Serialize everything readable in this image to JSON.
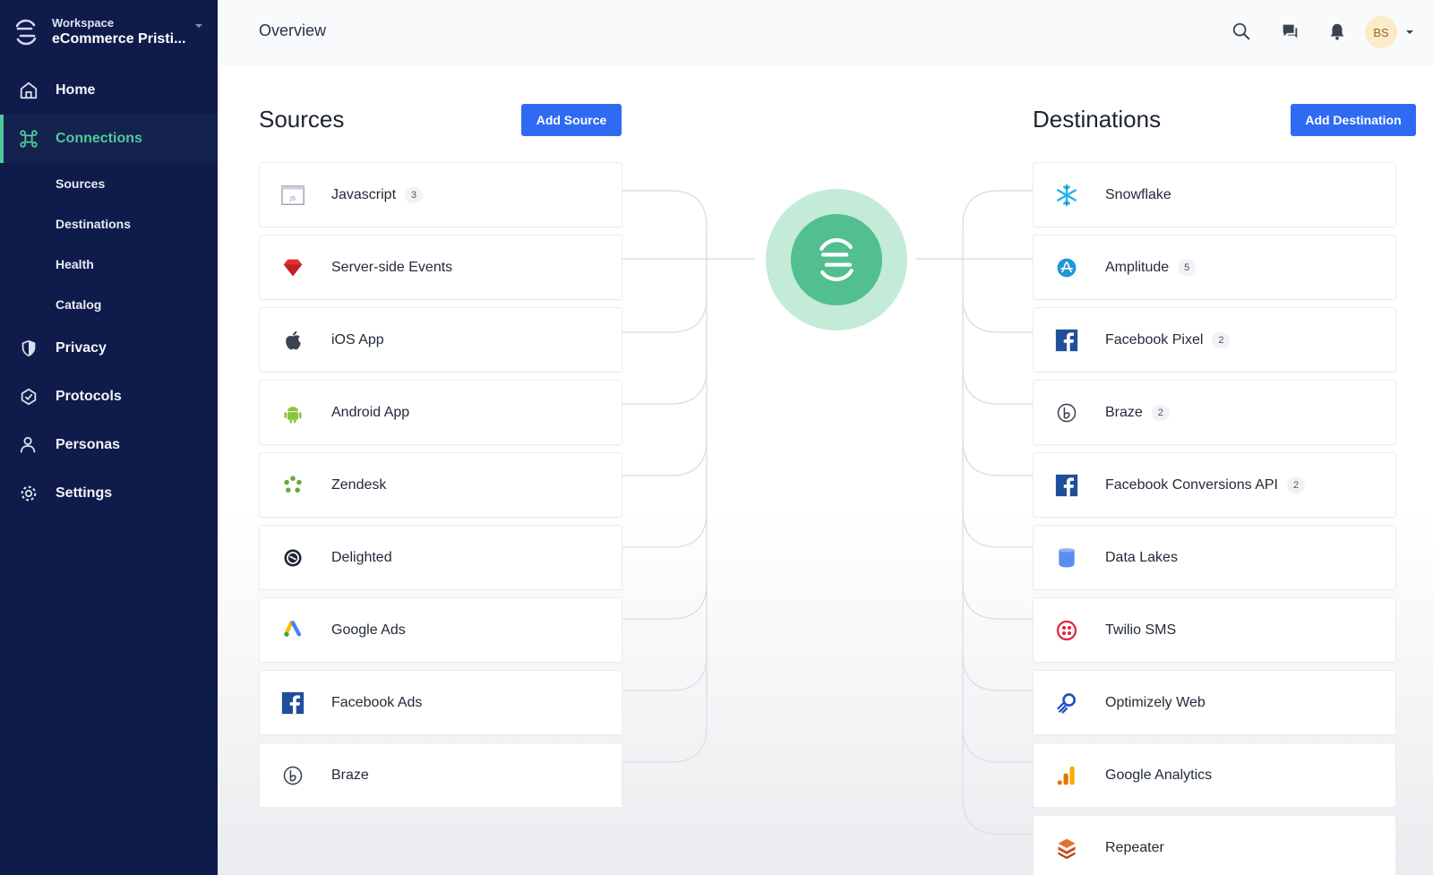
{
  "workspace": {
    "label": "Workspace",
    "name": "eCommerce Pristi..."
  },
  "nav": {
    "home": "Home",
    "connections": "Connections",
    "sub": [
      "Sources",
      "Destinations",
      "Health",
      "Catalog"
    ],
    "privacy": "Privacy",
    "protocols": "Protocols",
    "personas": "Personas",
    "settings": "Settings"
  },
  "topbar": {
    "title": "Overview",
    "avatar_initials": "BS"
  },
  "sources": {
    "title": "Sources",
    "add_label": "Add Source",
    "items": [
      {
        "label": "Javascript",
        "badge": "3",
        "icon": "javascript-icon"
      },
      {
        "label": "Server-side Events",
        "badge": "",
        "icon": "ruby-icon"
      },
      {
        "label": "iOS App",
        "badge": "",
        "icon": "apple-icon"
      },
      {
        "label": "Android App",
        "badge": "",
        "icon": "android-icon"
      },
      {
        "label": "Zendesk",
        "badge": "",
        "icon": "zendesk-icon"
      },
      {
        "label": "Delighted",
        "badge": "",
        "icon": "delighted-icon"
      },
      {
        "label": "Google Ads",
        "badge": "",
        "icon": "google-ads-icon"
      },
      {
        "label": "Facebook Ads",
        "badge": "",
        "icon": "facebook-icon"
      },
      {
        "label": "Braze",
        "badge": "",
        "icon": "braze-icon"
      }
    ]
  },
  "destinations": {
    "title": "Destinations",
    "add_label": "Add Destination",
    "items": [
      {
        "label": "Snowflake",
        "badge": "",
        "icon": "snowflake-icon"
      },
      {
        "label": "Amplitude",
        "badge": "5",
        "icon": "amplitude-icon"
      },
      {
        "label": "Facebook Pixel",
        "badge": "2",
        "icon": "facebook-icon"
      },
      {
        "label": "Braze",
        "badge": "2",
        "icon": "braze-icon"
      },
      {
        "label": "Facebook Conversions API",
        "badge": "2",
        "icon": "facebook-icon"
      },
      {
        "label": "Data Lakes",
        "badge": "",
        "icon": "data-lakes-icon"
      },
      {
        "label": "Twilio SMS",
        "badge": "",
        "icon": "twilio-icon"
      },
      {
        "label": "Optimizely Web",
        "badge": "",
        "icon": "optimizely-icon"
      },
      {
        "label": "Google Analytics",
        "badge": "",
        "icon": "google-analytics-icon"
      },
      {
        "label": "Repeater",
        "badge": "",
        "icon": "repeater-icon"
      }
    ]
  },
  "colors": {
    "sidebar": "#0f1b4a",
    "accent_green": "#52c89a",
    "button_blue": "#2f6bf2",
    "hub_outer": "#c4ead8",
    "hub_inner": "#52bf90"
  }
}
